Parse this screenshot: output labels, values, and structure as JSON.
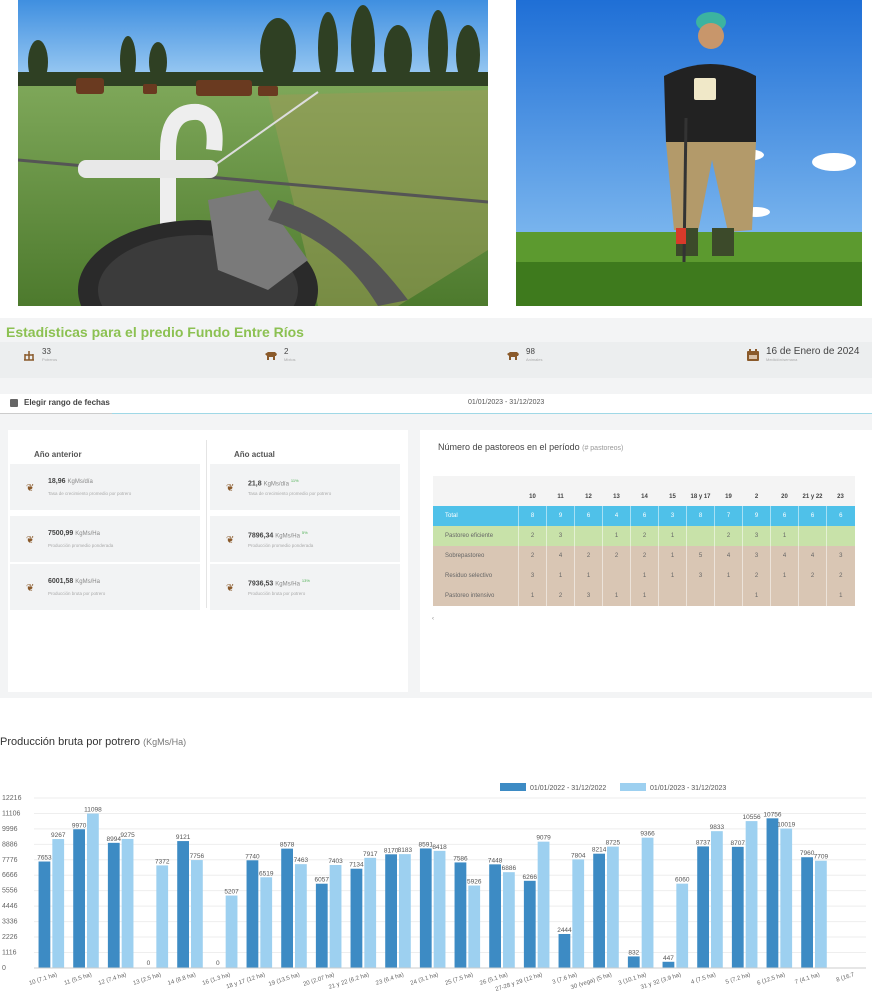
{
  "stats": {
    "title": "Estadísticas para el predio Fundo Entre Ríos",
    "items": [
      {
        "value": "33",
        "label": "Potreros",
        "icon": "paddock-icon"
      },
      {
        "value": "2",
        "label": "Mixtos",
        "icon": "cow-icon"
      },
      {
        "value": "98",
        "label": "Animales",
        "icon": "cow-icon"
      },
      {
        "value": "16 de Enero de 2024",
        "label": "Medición/semana",
        "icon": "calendar-icon"
      }
    ]
  },
  "range": {
    "label": "Elegir rango de fechas",
    "value": "01/01/2023 - 31/12/2023"
  },
  "comparison": {
    "prev_header": "Año anterior",
    "curr_header": "Año actual",
    "prev": [
      {
        "value": "18,96",
        "unit": "KgMs/día",
        "desc": "Tasa de crecimiento promedio por potrero"
      },
      {
        "value": "7500,99",
        "unit": "KgMs/Ha",
        "desc": "Producción promedio ponderada"
      },
      {
        "value": "6001,58",
        "unit": "KgMs/Ha",
        "desc": "Producción bruta por potrero"
      }
    ],
    "curr": [
      {
        "value": "21,8",
        "unit": "KgMs/día",
        "delta": "11%",
        "desc": "Tasa de crecimiento promedio por potrero"
      },
      {
        "value": "7896,34",
        "unit": "KgMs/Ha",
        "delta": "5%",
        "desc": "Producción promedio ponderada"
      },
      {
        "value": "7936,53",
        "unit": "KgMs/Ha",
        "delta": "13%",
        "desc": "Producción bruta por potrero"
      }
    ]
  },
  "pastoreos": {
    "title": "Número de pastoreos en el período",
    "unit": "(# pastoreos)",
    "columns": [
      "10",
      "11",
      "12",
      "13",
      "14",
      "15",
      "18 y 17",
      "19",
      "2",
      "20",
      "21 y 22",
      "23"
    ],
    "rows": [
      {
        "label": "Total",
        "values": [
          "8",
          "9",
          "6",
          "4",
          "6",
          "3",
          "8",
          "7",
          "9",
          "6",
          "6",
          "6"
        ]
      },
      {
        "label": "Pastoreo eficiente",
        "values": [
          "2",
          "3",
          "",
          "1",
          "2",
          "1",
          "",
          "2",
          "3",
          "1",
          "",
          ""
        ]
      },
      {
        "label": "Sobrepastoreo",
        "values": [
          "2",
          "4",
          "2",
          "2",
          "2",
          "1",
          "5",
          "4",
          "3",
          "4",
          "4",
          "3"
        ]
      },
      {
        "label": "Residuo selectivo",
        "values": [
          "3",
          "1",
          "1",
          "",
          "1",
          "1",
          "3",
          "1",
          "2",
          "1",
          "2",
          "2"
        ]
      },
      {
        "label": "Pastoreo intensivo",
        "values": [
          "1",
          "2",
          "3",
          "1",
          "1",
          "",
          "",
          "",
          "1",
          "",
          "",
          "1"
        ]
      }
    ]
  },
  "chart_title": "Producción bruta por potrero",
  "chart_unit": "(KgMs/Ha)",
  "chart_data": {
    "type": "bar",
    "title": "Producción bruta por potrero (KgMs/Ha)",
    "xlabel": "",
    "ylabel": "",
    "ylim": [
      0,
      12216
    ],
    "yticks": [
      "12216",
      "11106",
      "9996",
      "8886",
      "7776",
      "6666",
      "5556",
      "4446",
      "3336",
      "2226",
      "1116",
      "0"
    ],
    "legend_position": "top-right",
    "categories": [
      "10 (7.1 ha)",
      "11 (5.5 ha)",
      "12 (7.4 ha)",
      "13 (2.5 ha)",
      "14 (8.8 ha)",
      "16 (1.3 ha)",
      "18 y 17 (12 ha)",
      "19 (13.5 ha)",
      "20 (2.07 ha)",
      "21 y 22 (6.2 ha)",
      "23 (6.4 ha)",
      "24 (3.1 ha)",
      "25 (7.5 ha)",
      "26 (5.1 ha)",
      "27-28 y 29 (12 ha)",
      "3 (7.6 ha)",
      "30 (vega) (5 ha)",
      "3 (10.1 ha)",
      "31 y 32 (3.9 ha)",
      "4 (7.5 ha)",
      "5 (7.2 ha)",
      "6 (12.5 ha)",
      "7 (4.1 ha)",
      "8 (16.7"
    ],
    "series": [
      {
        "name": "01/01/2022 - 31/12/2022",
        "color": "#3d8bc4",
        "values": [
          7653,
          9970,
          8994,
          0,
          9121,
          0,
          7740,
          8578,
          6057,
          7134,
          8170,
          8591,
          7586,
          7448,
          6266,
          2444,
          8214,
          832,
          447,
          8737,
          8707,
          10756,
          7960,
          null
        ]
      },
      {
        "name": "01/01/2023 - 31/12/2023",
        "color": "#9dd0f0",
        "values": [
          9267,
          11098,
          9275,
          7372,
          7756,
          5207,
          6519,
          7463,
          7403,
          7917,
          8183,
          8418,
          5926,
          6886,
          9079,
          7804,
          8725,
          9366,
          6060,
          9833,
          10556,
          10019,
          7709,
          null
        ]
      }
    ]
  }
}
